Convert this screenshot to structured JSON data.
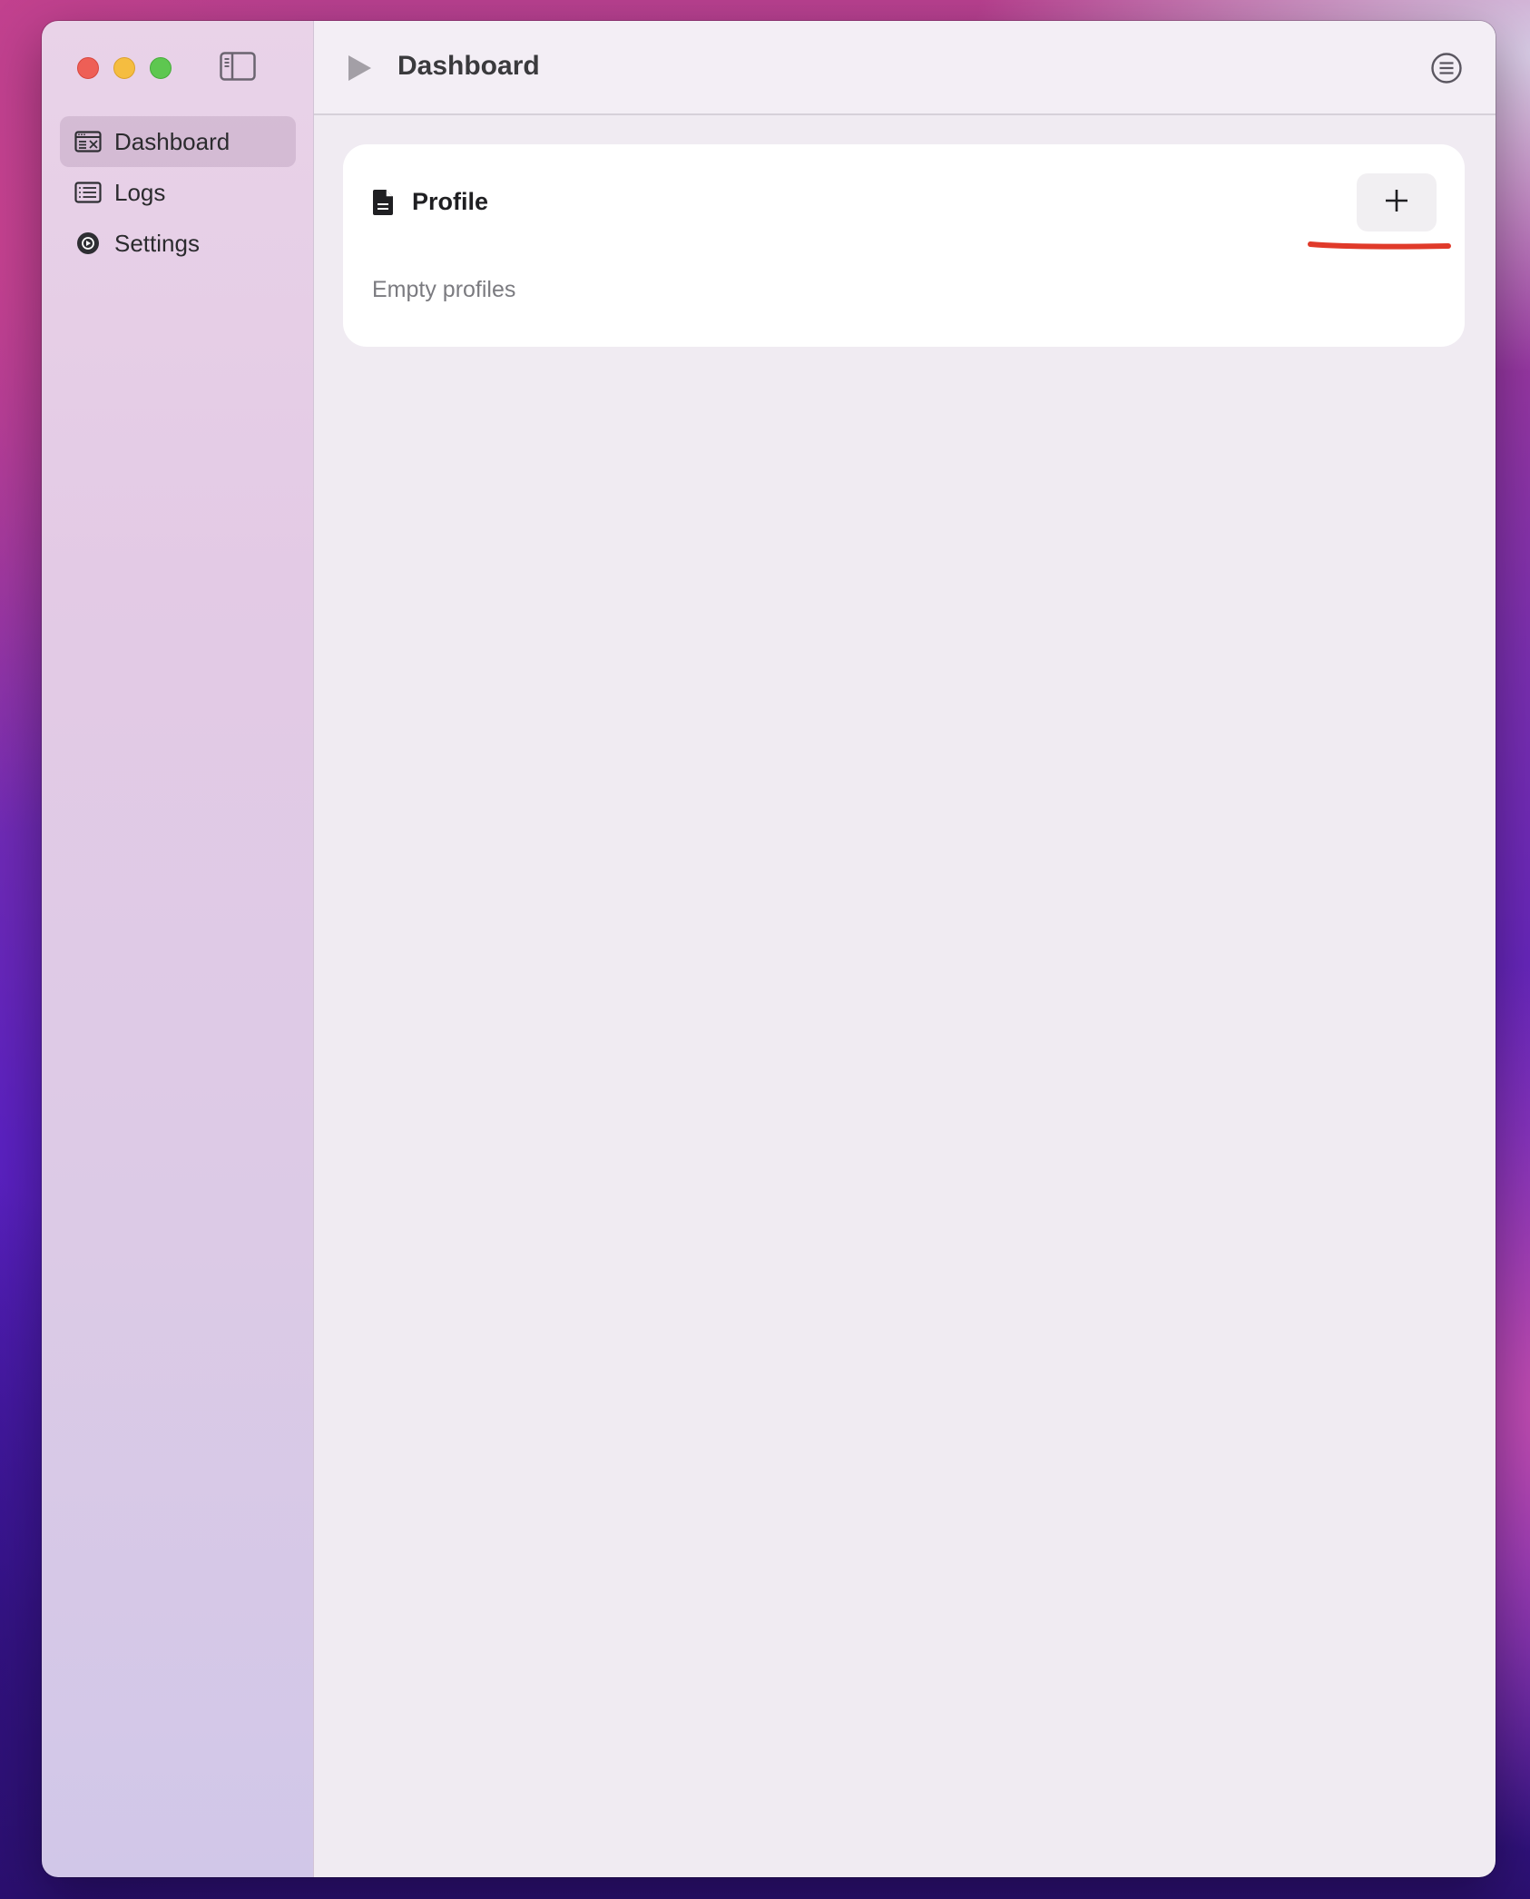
{
  "sidebar": {
    "items": [
      {
        "label": "Dashboard",
        "icon": "dashboard-icon",
        "active": true
      },
      {
        "label": "Logs",
        "icon": "logs-icon",
        "active": false
      },
      {
        "label": "Settings",
        "icon": "settings-icon",
        "active": false
      }
    ]
  },
  "toolbar": {
    "title": "Dashboard",
    "play_icon": "play-icon",
    "menu_icon": "list-menu-icon"
  },
  "profile_card": {
    "title": "Profile",
    "icon": "document-icon",
    "add_button_icon": "plus-icon",
    "empty_text": "Empty profiles"
  },
  "colors": {
    "annotation": "#e03a2a",
    "traffic_red": "#ee5f56",
    "traffic_yellow": "#f5bd40",
    "traffic_green": "#5ec750"
  }
}
